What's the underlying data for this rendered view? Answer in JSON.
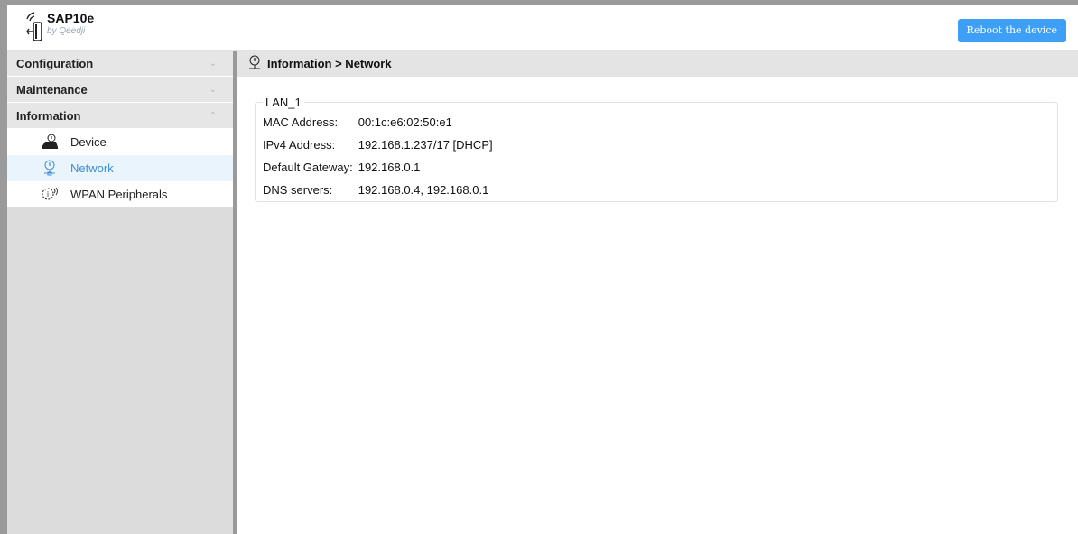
{
  "header": {
    "brand_name": "SAP10e",
    "brand_sub": "by Qeedji",
    "reboot_label": "Reboot the device"
  },
  "sidebar": {
    "sections": [
      {
        "label": "Configuration",
        "state": "collapsed"
      },
      {
        "label": "Maintenance",
        "state": "collapsed"
      },
      {
        "label": "Information",
        "state": "expanded"
      }
    ],
    "items": [
      {
        "label": "Device",
        "icon": "device-icon"
      },
      {
        "label": "Network",
        "icon": "network-icon",
        "active": true
      },
      {
        "label": "WPAN Peripherals",
        "icon": "wpan-icon"
      }
    ]
  },
  "breadcrumb": "Information > Network",
  "lan": {
    "legend": "LAN_1",
    "rows": [
      {
        "label": "MAC Address:",
        "value": "00:1c:e6:02:50:e1"
      },
      {
        "label": "IPv4 Address:",
        "value": "192.168.1.237/17 [DHCP]"
      },
      {
        "label": "Default Gateway:",
        "value": "192.168.0.1"
      },
      {
        "label": "DNS servers:",
        "value": "192.168.0.4, 192.168.0.1"
      }
    ]
  },
  "colors": {
    "accent": "#3d9ff5",
    "active_text": "#3d8fd6",
    "active_bg": "#eaf4fc",
    "frame": "#9a9a9a"
  }
}
